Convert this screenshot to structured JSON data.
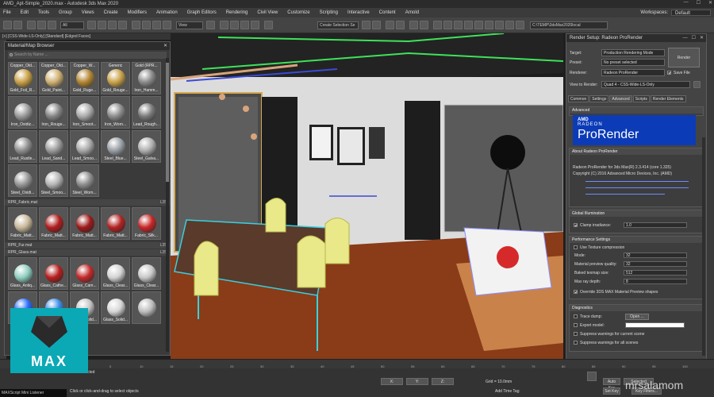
{
  "window": {
    "title": "AMD_Apt-Simple_2020.max - Autodesk 3ds Max 2020",
    "controls": [
      "—",
      "☐",
      "✕"
    ]
  },
  "menu": {
    "items": [
      "File",
      "Edit",
      "Tools",
      "Group",
      "Views",
      "Create",
      "Modifiers",
      "Animation",
      "Graph Editors",
      "Rendering",
      "Civil View",
      "Customize",
      "Scripting",
      "Interactive",
      "Content",
      "Arnold"
    ],
    "workspaces_label": "Workspaces:",
    "workspaces_value": "Default"
  },
  "toolbar": {
    "view_combo": "View",
    "all_combo": "All",
    "selection_set_combo": "Create Selection Se",
    "project_path": "C:\\TEMP\\3dsMax2020local"
  },
  "viewport": {
    "label": "[+] [CSS-Wide-LS-Only] [Standard] [Edged Faces]",
    "wall_color": "#dcdcdc",
    "floor_color": "#8a3b17",
    "rug_color": "#c9834a"
  },
  "material_browser": {
    "title": "Material/Map Browser",
    "close": "✕",
    "search_placeholder": "Search by Name ...",
    "sections": [
      {
        "name": "",
        "count": "",
        "swatches": [
          {
            "top": "Copper_Old...",
            "label": "Gold_Foil_R...",
            "color": "#c9a046"
          },
          {
            "top": "Copper_Old...",
            "label": "Gold_Paint...",
            "color": "#cfb072"
          },
          {
            "top": "Copper_W...",
            "label": "Gold_Ruge...",
            "color": "#b28531"
          },
          {
            "top": "Generic",
            "label": "Gold_Rouge...",
            "color": "#c9a24a"
          },
          {
            "top": "Gold (RPR...",
            "label": "Iron_Hamm...",
            "color": "#8a8a8a"
          },
          {
            "top": "",
            "label": "Iron_Oxidiz...",
            "color": "#9a9a9a"
          },
          {
            "top": "",
            "label": "Iron_Rouge...",
            "color": "#858585"
          },
          {
            "top": "",
            "label": "Iron_Smoot...",
            "color": "#aaaaaa"
          },
          {
            "top": "",
            "label": "Iron_Worn...",
            "color": "#8c8c8c"
          },
          {
            "top": "",
            "label": "Lead_Rough...",
            "color": "#7a7a7a"
          },
          {
            "top": "",
            "label": "Lead_Rustle...",
            "color": "#8f8f8f"
          },
          {
            "top": "",
            "label": "Lead_Sand...",
            "color": "#9b9b9b"
          },
          {
            "top": "",
            "label": "Lead_Smoo...",
            "color": "#a8a8a8"
          },
          {
            "top": "",
            "label": "Steel_Blue...",
            "color": "#9aa0a6"
          },
          {
            "top": "",
            "label": "Steel_Galva...",
            "color": "#b0b0b0"
          },
          {
            "top": "",
            "label": "Steel_Oxidi...",
            "color": "#969696"
          },
          {
            "top": "",
            "label": "Steel_Smoo...",
            "color": "#b5b5b5"
          },
          {
            "top": "",
            "label": "Steel_Worn...",
            "color": "#8d8d8d"
          }
        ]
      },
      {
        "name": "RPR_Fabric.mat",
        "count": "L35",
        "swatches": [
          {
            "top": "",
            "label": "Fabric_Matt...",
            "color": "#c8b89a"
          },
          {
            "top": "",
            "label": "Fabric_Matt...",
            "color": "#b01e1e"
          },
          {
            "top": "",
            "label": "Fabric_Matt...",
            "color": "#9d1a1a"
          },
          {
            "top": "",
            "label": "Fabric_Matt...",
            "color": "#b32323"
          },
          {
            "top": "",
            "label": "Fabric_Silk...",
            "color": "#c72727"
          }
        ]
      },
      {
        "name": "RPR_Fur.mat",
        "count": "L35",
        "swatches": []
      },
      {
        "name": "RPR_Glass.mat",
        "count": "L35",
        "swatches": [
          {
            "top": "",
            "label": "Glass_Antiq...",
            "color": "#8fcfc0"
          },
          {
            "top": "",
            "label": "Glass_Cathe...",
            "color": "#b71f1f"
          },
          {
            "top": "",
            "label": "Glass_Cam...",
            "color": "#c22a2a"
          },
          {
            "top": "",
            "label": "Glass_Clear...",
            "color": "#d3d3d3"
          },
          {
            "top": "",
            "label": "Glass_Clear...",
            "color": "#c8c8c8"
          },
          {
            "top": "",
            "label": "",
            "color": "#2a6cff"
          },
          {
            "top": "",
            "label": "Glass_Solid...",
            "color": "#3b8de6"
          },
          {
            "top": "",
            "label": "Glass_Solid...",
            "color": "#c4c4c4"
          },
          {
            "top": "",
            "label": "Glass_Solid...",
            "color": "#d6d6d6"
          },
          {
            "top": "",
            "label": "",
            "color": "#bdbdbd"
          }
        ]
      }
    ]
  },
  "render_setup": {
    "title": "Render Setup: Radeon ProRender",
    "target_label": "Target:",
    "target_value": "Production Rendering Mode",
    "preset_label": "Preset:",
    "preset_value": "No preset selected",
    "renderer_label": "Renderer:",
    "renderer_value": "Radeon ProRender",
    "save_file": "Save File",
    "render_button": "Render",
    "view_label": "View to Render:",
    "view_value": "Quad 4 - CSS-Wide-LS-Only",
    "tabs": [
      "Common",
      "Settings",
      "Advanced",
      "Scripts",
      "Render Elements"
    ],
    "active_tab": "Advanced",
    "advanced_header": "Advanced",
    "amd_logo": "AMD",
    "banner_radeon": "RADEON",
    "banner_prorender": "ProRender",
    "about_header": "About Radeon ProRender",
    "about_lines": [
      "Radeon ProRender for 3ds Max(R) 2.3.414 (core 1.325)",
      "Copyright (C) 2016 Advanced Micro Devices, Inc. (AMD)"
    ],
    "gi_header": "Global Illumination",
    "clamp_label": "Clamp irradiance:",
    "clamp_value": "1.0",
    "perf_header": "Performance Settings",
    "use_texture_compression": "Use Texture compression",
    "mode_label": "Mode:",
    "mode_value": "32",
    "mat_preview_label": "Material preview quality:",
    "mat_preview_value": "32",
    "baked_label": "Baked texmap size:",
    "baked_value": "512",
    "max_ray_label": "Max ray depth:",
    "max_ray_value": "8",
    "override_label": "Override 3DS MAX Material Preview shapes",
    "diag_header": "Diagnostics",
    "trace_label": "Trace dump:",
    "open_button": "Open ...",
    "export_label": "Export model:",
    "suppress1": "Suppress warnings for current scene",
    "suppress2": "Suppress warnings for all scenes"
  },
  "timeline": {
    "ticks": [
      "0",
      "5",
      "10",
      "15",
      "20",
      "25",
      "30",
      "35",
      "40",
      "45",
      "50",
      "55",
      "60",
      "65",
      "70",
      "75",
      "80",
      "85",
      "90",
      "95",
      "100"
    ]
  },
  "status": {
    "selected": "Selected",
    "hint": "Click or click-and-drag to select objects",
    "grid": "Grid = 10.0mm",
    "add_time_tag": "Add Time Tag",
    "auto_key": "Auto Key",
    "selected_combo": "Selected",
    "set_key": "Set Key",
    "key_filters": "Key Filters...",
    "maxscript": "MAXScript Mini Listener",
    "coords": [
      "X: ",
      "Y: ",
      "Z: "
    ]
  },
  "logo": {
    "text": "MAX",
    "color": "#0aa9b5"
  },
  "watermark": "mrsalamom"
}
